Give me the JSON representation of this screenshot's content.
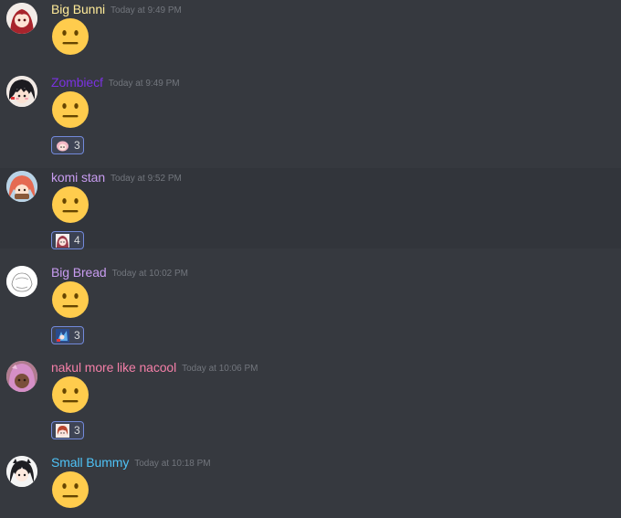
{
  "colors": {
    "background": "#36393f",
    "timestamp": "#72767d",
    "reaction_border": "#7289da",
    "emoji_face": "#ffcc4d"
  },
  "messages": [
    {
      "username": "Big Bunni",
      "name_color": "#ffeb99",
      "timestamp": "Today at 9:49 PM",
      "emoji": "neutral-face",
      "reaction": null
    },
    {
      "username": "Zombiecf",
      "name_color": "#7a32e0",
      "timestamp": "Today at 9:49 PM",
      "emoji": "neutral-face",
      "reaction": {
        "icon": "anime-girl-sticker",
        "count": "3"
      }
    },
    {
      "username": "komi stan",
      "name_color": "#c89cf0",
      "timestamp": "Today at 9:52 PM",
      "emoji": "neutral-face",
      "reaction": {
        "icon": "anime-girl-sticker",
        "count": "4"
      }
    },
    {
      "username": "Big Bread",
      "name_color": "#c89cf0",
      "timestamp": "Today at 10:02 PM",
      "emoji": "neutral-face",
      "reaction": {
        "icon": "anime-character-sticker",
        "count": "3"
      }
    },
    {
      "username": "nakul more like nacool",
      "name_color": "#f47fa8",
      "timestamp": "Today at 10:06 PM",
      "emoji": "neutral-face",
      "reaction": {
        "icon": "anime-girl-sticker",
        "count": "3"
      }
    },
    {
      "username": "Small Bummy",
      "name_color": "#4fc3f7",
      "timestamp": "Today at 10:18 PM",
      "emoji": "neutral-face",
      "reaction": null
    }
  ]
}
